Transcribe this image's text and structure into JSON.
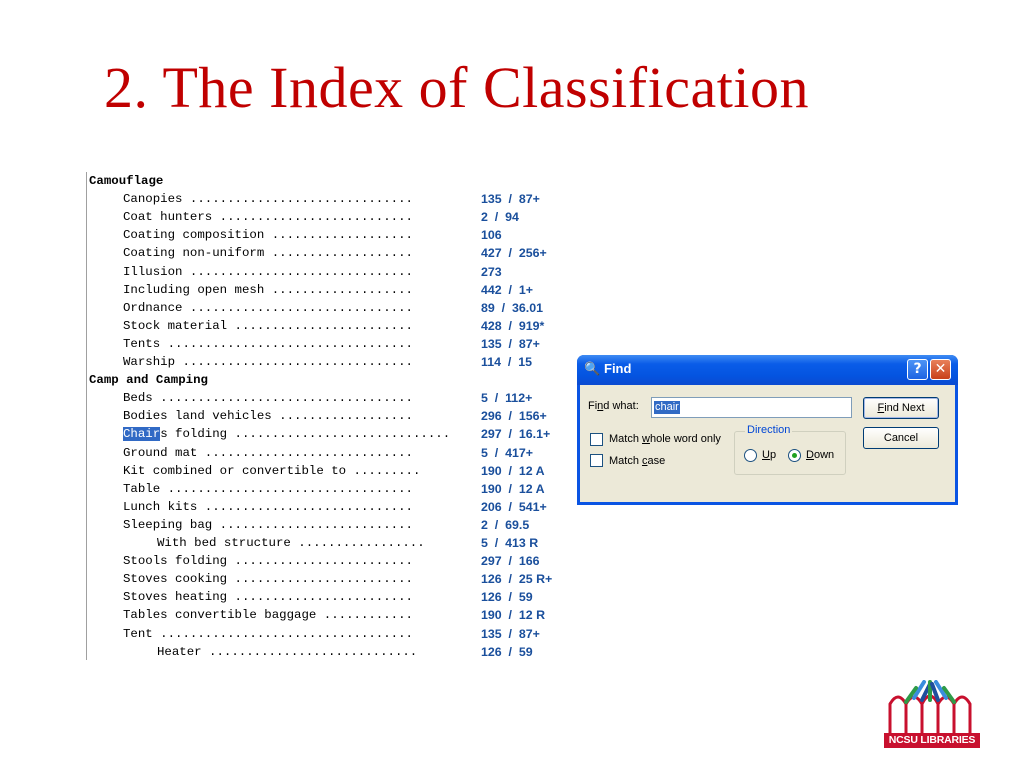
{
  "slide": {
    "title": "2.  The Index of Classification"
  },
  "index": {
    "rows": [
      {
        "text": "Camouflage",
        "ref": "",
        "indent": 0,
        "heading": true
      },
      {
        "text": "Canopies ..............................",
        "ref": "135  /  87+",
        "indent": 1
      },
      {
        "text": "Coat hunters ..........................",
        "ref": "2  /  94",
        "indent": 1
      },
      {
        "text": "Coating composition ...................",
        "ref": "106",
        "indent": 1
      },
      {
        "text": "Coating non-uniform ...................",
        "ref": "427  /  256+",
        "indent": 1
      },
      {
        "text": "Illusion ..............................",
        "ref": "273",
        "indent": 1
      },
      {
        "text": "Including open mesh ...................",
        "ref": "442  /  1+",
        "indent": 1
      },
      {
        "text": "Ordnance ..............................",
        "ref": "89  /  36.01",
        "indent": 1
      },
      {
        "text": "Stock material ........................",
        "ref": "428  /  919*",
        "indent": 1
      },
      {
        "text": "Tents .................................",
        "ref": "135  /  87+",
        "indent": 1
      },
      {
        "text": "Warship ...............................",
        "ref": "114  /  15",
        "indent": 1
      },
      {
        "text": "Camp and Camping",
        "ref": "",
        "indent": 0,
        "heading": true
      },
      {
        "text": "Beds ..................................",
        "ref": "5  /  112+",
        "indent": 1
      },
      {
        "text": "Bodies land vehicles ..................",
        "ref": "296  /  156+",
        "indent": 1
      },
      {
        "text": "s folding .............................",
        "ref": "297  /  16.1+",
        "indent": 1,
        "highlight": "Chair"
      },
      {
        "text": "Ground mat ............................",
        "ref": "5  /  417+",
        "indent": 1
      },
      {
        "text": "Kit combined or convertible to .........",
        "ref": "190  /  12 A",
        "indent": 1
      },
      {
        "text": "Table .................................",
        "ref": "190  /  12 A",
        "indent": 1
      },
      {
        "text": "Lunch kits ............................",
        "ref": "206  /  541+",
        "indent": 1
      },
      {
        "text": "Sleeping bag ..........................",
        "ref": "2  /  69.5",
        "indent": 1
      },
      {
        "text": "With bed structure .................",
        "ref": "5  /  413 R",
        "indent": 2
      },
      {
        "text": "Stools folding ........................",
        "ref": "297  /  166",
        "indent": 1
      },
      {
        "text": "Stoves cooking ........................",
        "ref": "126  /  25 R+",
        "indent": 1
      },
      {
        "text": "Stoves heating ........................",
        "ref": "126  /  59",
        "indent": 1
      },
      {
        "text": "Tables convertible baggage ............",
        "ref": "190  /  12 R",
        "indent": 1
      },
      {
        "text": "Tent ..................................",
        "ref": "135  /  87+",
        "indent": 1
      },
      {
        "text": "Heater ............................",
        "ref": "126  /  59",
        "indent": 2
      }
    ]
  },
  "find_dialog": {
    "title": "Find",
    "find_what_label_pre": "Fi",
    "find_what_label_u": "n",
    "find_what_label_post": "d what:",
    "find_value": "chair",
    "find_next_u": "F",
    "find_next_rest": "ind Next",
    "cancel_label": "Cancel",
    "whole_word_pre": "Match ",
    "whole_word_u": "w",
    "whole_word_post": "hole word only",
    "case_pre": "Match ",
    "case_u": "c",
    "case_post": "ase",
    "direction_label": "Direction",
    "up_u": "U",
    "up_rest": "p",
    "down_u": "D",
    "down_rest": "own",
    "whole_word_checked": false,
    "match_case_checked": false,
    "direction_selected": "Down",
    "help_glyph": "?",
    "close_glyph": "✕"
  },
  "logo": {
    "text": "NCSU LIBRARIES",
    "colors": [
      "#c8102e",
      "#3a8dde",
      "#1f4e9c",
      "#2e9b48"
    ]
  }
}
